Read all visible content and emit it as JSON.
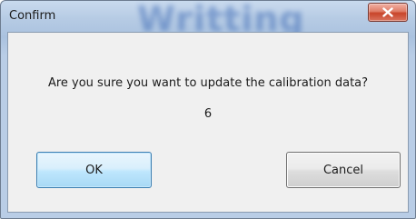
{
  "window": {
    "title": "Confirm",
    "background_title": "Writting"
  },
  "dialog": {
    "message": "Are you sure you want to update the calibration data?",
    "value": "6"
  },
  "buttons": {
    "ok_label": "OK",
    "cancel_label": "Cancel"
  },
  "icons": {
    "close": "close-icon"
  },
  "colors": {
    "close_button": "#c8442a",
    "ok_button_border": "#3c7fb1",
    "client_background": "#f0f0f0"
  }
}
